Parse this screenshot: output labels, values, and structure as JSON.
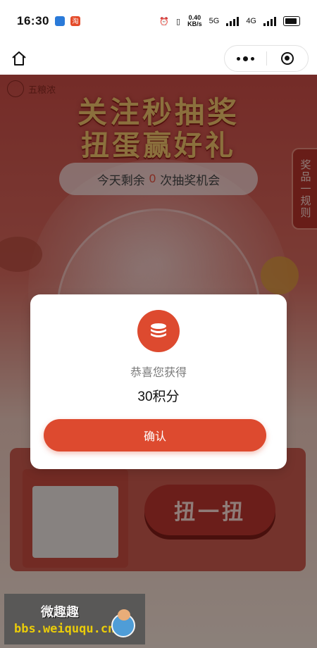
{
  "status_bar": {
    "time": "16:30",
    "app_badge_1": "",
    "app_badge_2": "淘",
    "net_speed_value": "0.40",
    "net_speed_unit": "KB/s",
    "network_1": "5G",
    "network_2": "4G"
  },
  "page": {
    "brand_name": "五粮浓",
    "headline_1": "关注秒抽奖",
    "headline_2": "扭蛋赢好礼",
    "chance_prefix": "今天剩余",
    "chance_count": "0",
    "chance_suffix": "次抽奖机会",
    "side_tab_label": "奖品一规则",
    "spin_button_label": "扭一扭"
  },
  "modal": {
    "subtitle": "恭喜您获得",
    "reward": "30积分",
    "confirm_label": "确认"
  },
  "watermark": {
    "title": "微趣趣",
    "url": "bbs.weiququ.cn"
  },
  "colors": {
    "accent": "#dd4a2f",
    "modal_bg": "#ffffff"
  }
}
